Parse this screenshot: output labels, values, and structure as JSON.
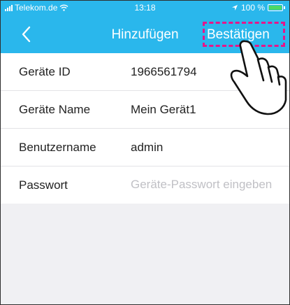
{
  "status_bar": {
    "carrier": "Telekom.de",
    "time": "13:18",
    "battery": "100 %"
  },
  "nav": {
    "title": "Hinzufügen",
    "confirm_label": "Bestätigen"
  },
  "form": {
    "device_id_label": "Geräte ID",
    "device_id_value": "1966561794",
    "device_name_label": "Geräte Name",
    "device_name_value": "Mein Gerät1",
    "username_label": "Benutzername",
    "username_value": "admin",
    "password_label": "Passwort",
    "password_placeholder": "Geräte-Passwort eingeben"
  },
  "colors": {
    "header": "#2ab7ec",
    "highlight": "#e6168a",
    "background": "#f0f0f3"
  },
  "icons": [
    "signal-icon",
    "wifi-icon",
    "location-icon",
    "battery-icon",
    "back-chevron-icon",
    "pointing-hand-icon"
  ]
}
